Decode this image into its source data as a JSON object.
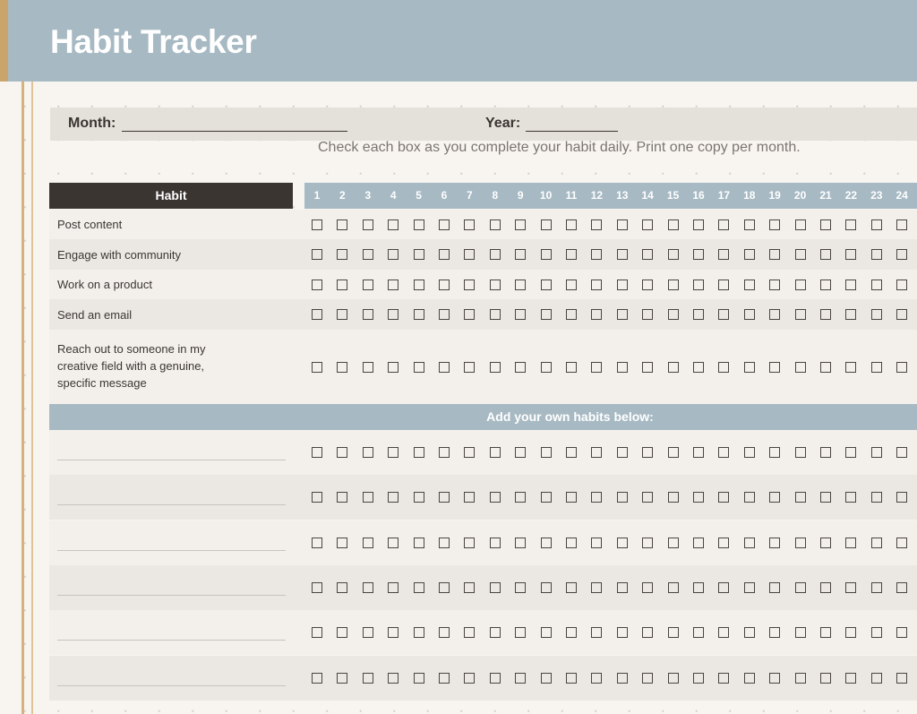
{
  "header": {
    "title": "Habit Tracker"
  },
  "meta": {
    "month_label": "Month:",
    "year_label": "Year:"
  },
  "instructions": "Check each box as you complete your habit daily. Print one copy per month.",
  "table": {
    "habit_header": "Habit",
    "days": [
      "1",
      "2",
      "3",
      "4",
      "5",
      "6",
      "7",
      "8",
      "9",
      "10",
      "11",
      "12",
      "13",
      "14",
      "15",
      "16",
      "17",
      "18",
      "19",
      "20",
      "21",
      "22",
      "23",
      "24"
    ],
    "habits": [
      {
        "label": "Post content",
        "checked": []
      },
      {
        "label": "Engage with community",
        "checked": []
      },
      {
        "label": "Work on a product",
        "checked": []
      },
      {
        "label": "Send an email",
        "checked": []
      },
      {
        "label": "Reach out to someone in my creative field with a genuine, specific message",
        "checked": []
      }
    ],
    "add_label": "Add your own habits below:",
    "custom_rows": 6
  },
  "colors": {
    "header_blue": "#a7b9c3",
    "dark_brown": "#3b3532",
    "gold_accent": "#c9a56b",
    "paper": "#f8f5f1"
  }
}
